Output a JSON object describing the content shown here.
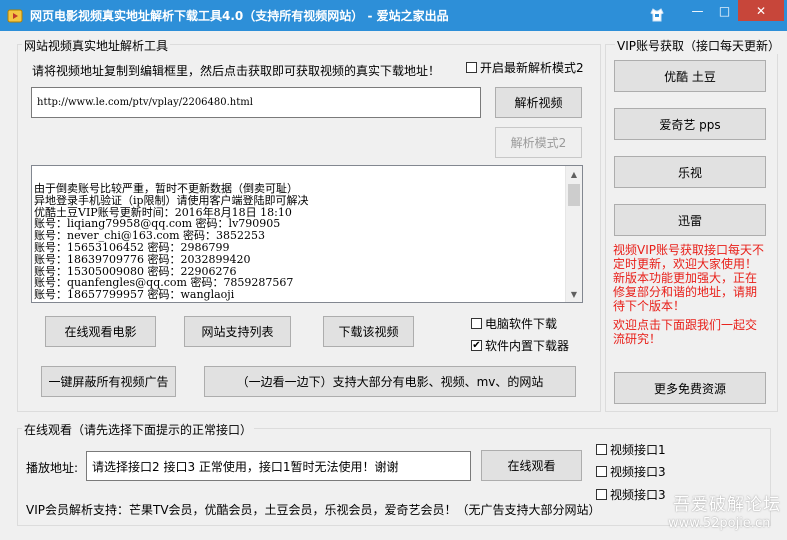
{
  "window": {
    "title": "网页电影视频真实地址解析下载工具4.0（支持所有视频网站） - 爱站之家出品",
    "minimize": "—",
    "maximize": "□",
    "close": "✕"
  },
  "parser_group": {
    "label": "网站视频真实地址解析工具",
    "instruction": "请将视频地址复制到编辑框里，然后点击获取即可获取视频的真实下载地址！",
    "latest_mode_checkbox": "开启最新解析模式2",
    "url_value": "http://www.le.com/ptv/vplay/2206480.html",
    "parse_button": "解析视频",
    "parse_mode2_button": "解析模式2",
    "textarea_lines": [
      "由于倒卖账号比较严重，暂时不更新数据（倒卖可耻）",
      "异地登录手机验证（ip限制）请使用客户端登陆即可解决",
      "优酷土豆VIP账号更新时间：2016年8月18日 18:10",
      "账号：liqiang79958@qq.com 密码：lv790905",
      "账号：never_chi@163.com 密码：3852253",
      "账号：15653106452 密码：2986799",
      "账号：18639709776 密码：2032899420",
      "账号：15305009080 密码：22906276",
      "账号：quanfengles@qq.com 密码：7859287567",
      "账号：18657799957 密码：wanglaoji"
    ],
    "watch_online_movie_button": "在线观看电影",
    "site_list_button": "网站支持列表",
    "download_button": "下载该视频",
    "pc_download_checkbox": "电脑软件下载",
    "builtin_download_checkbox": "软件内置下载器",
    "block_ads_button": "一键屏蔽所有视频广告",
    "edge_watch_button": "（一边看一边下）支持大部分有电影、视频、mv、的网站"
  },
  "vip_group": {
    "label": "VIP账号获取（接口每天更新）",
    "buttons": [
      "优酷 土豆",
      "爱奇艺 pps",
      "乐视",
      "迅雷"
    ],
    "notice_lines": [
      "视频VIP账号获取接口每天不",
      "定时更新，欢迎大家使用！",
      "新版本功能更加强大，正在",
      "修复部分和谐的地址，请期",
      "待下个版本！"
    ],
    "invite_lines": [
      "欢迎点击下面跟我们一起交",
      "流研究！"
    ],
    "more_button": "更多免费资源"
  },
  "online_group": {
    "label": "在线观看（请先选择下面提示的正常接口）",
    "play_address_label": "播放地址:",
    "play_address_value": "请选择接口2 接口3 正常使用，接口1暂时无法使用！谢谢",
    "watch_button": "在线观看",
    "vip_support_text": "VIP会员解析支持：芒果TV会员，优酷会员，土豆会员，乐视会员，爱奇艺会员！（无广告支持大部分网站）",
    "interfaces": [
      "视频接口1",
      "视频接口3",
      "视频接口3"
    ]
  },
  "watermark": {
    "line1": "吾爱破解论坛",
    "line2": "www.52pojie.cn"
  },
  "colors": {
    "titlebar": "#2d8fd8",
    "close": "#c7463a",
    "notice": "#e8201a"
  },
  "icons": [
    "app-icon",
    "skin-icon",
    "check-icon",
    "scroll-up-icon",
    "scroll-down-icon"
  ]
}
